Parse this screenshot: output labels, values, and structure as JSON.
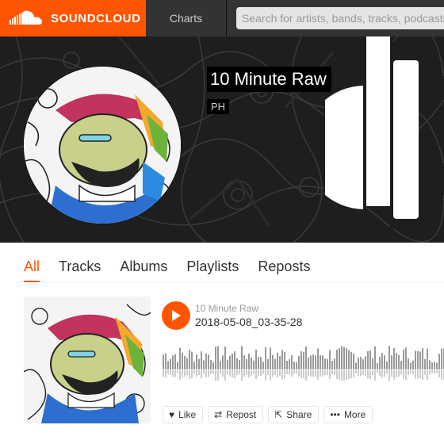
{
  "header": {
    "brand": "SOUNDCLOUD",
    "nav_charts": "Charts",
    "search_placeholder": "Search for artists, bands, tracks, podcasts"
  },
  "profile": {
    "name": "10 Minute Raw",
    "location": "PH"
  },
  "tabs": [
    {
      "label": "All",
      "active": true
    },
    {
      "label": "Tracks",
      "active": false
    },
    {
      "label": "Albums",
      "active": false
    },
    {
      "label": "Playlists",
      "active": false
    },
    {
      "label": "Reposts",
      "active": false
    }
  ],
  "track": {
    "user": "10 Minute Raw",
    "title": "2018-05-08_03-35-28",
    "actions": {
      "like": "Like",
      "repost": "Repost",
      "share": "Share",
      "more": "More"
    }
  },
  "colors": {
    "accent": "#ff5500",
    "topbar": "#333333",
    "waveform": "#999999"
  },
  "icons": [
    "soundcloud-logo-icon",
    "play-icon",
    "heart-icon",
    "repost-icon",
    "share-icon",
    "more-icon"
  ]
}
